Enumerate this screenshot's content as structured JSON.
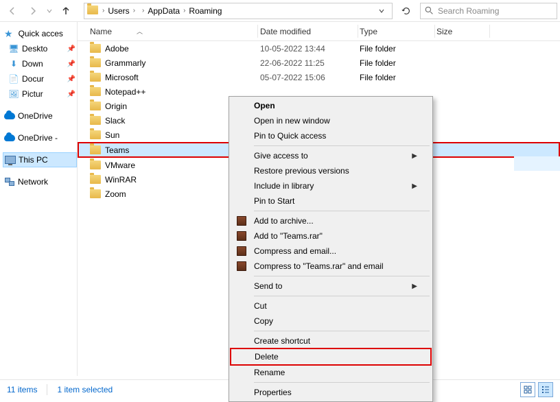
{
  "breadcrumb": {
    "items": [
      "Users",
      "",
      "AppData",
      "Roaming"
    ]
  },
  "search": {
    "placeholder": "Search Roaming"
  },
  "columns": {
    "name": "Name",
    "date": "Date modified",
    "type": "Type",
    "size": "Size"
  },
  "sidebar": {
    "quick": "Quick acces",
    "quick_items": [
      "Deskto",
      "Down",
      "Docur",
      "Pictur"
    ],
    "onedrive1": "OneDrive",
    "onedrive2": "OneDrive -",
    "thispc": "This PC",
    "network": "Network"
  },
  "rows": [
    {
      "name": "Adobe",
      "date": "10-05-2022 13:44",
      "type": "File folder",
      "size": ""
    },
    {
      "name": "Grammarly",
      "date": "22-06-2022 11:25",
      "type": "File folder",
      "size": ""
    },
    {
      "name": "Microsoft",
      "date": "05-07-2022 15:06",
      "type": "File folder",
      "size": ""
    },
    {
      "name": "Notepad++",
      "date": "",
      "type": "",
      "size": ""
    },
    {
      "name": "Origin",
      "date": "",
      "type": "",
      "size": ""
    },
    {
      "name": "Slack",
      "date": "",
      "type": "",
      "size": ""
    },
    {
      "name": "Sun",
      "date": "",
      "type": "",
      "size": ""
    },
    {
      "name": "Teams",
      "date": "",
      "type": "",
      "size": ""
    },
    {
      "name": "VMware",
      "date": "",
      "type": "",
      "size": ""
    },
    {
      "name": "WinRAR",
      "date": "",
      "type": "",
      "size": ""
    },
    {
      "name": "Zoom",
      "date": "",
      "type": "",
      "size": ""
    }
  ],
  "selected_index": 7,
  "context_menu": {
    "open": "Open",
    "open_new": "Open in new window",
    "pin_quick": "Pin to Quick access",
    "give_access": "Give access to",
    "restore_prev": "Restore previous versions",
    "include_lib": "Include in library",
    "pin_start": "Pin to Start",
    "add_archive": "Add to archive...",
    "add_teams_rar": "Add to \"Teams.rar\"",
    "compress_email": "Compress and email...",
    "compress_teams_email": "Compress to \"Teams.rar\" and email",
    "send_to": "Send to",
    "cut": "Cut",
    "copy": "Copy",
    "create_shortcut": "Create shortcut",
    "delete": "Delete",
    "rename": "Rename",
    "properties": "Properties"
  },
  "status": {
    "items": "11 items",
    "selected": "1 item selected"
  }
}
